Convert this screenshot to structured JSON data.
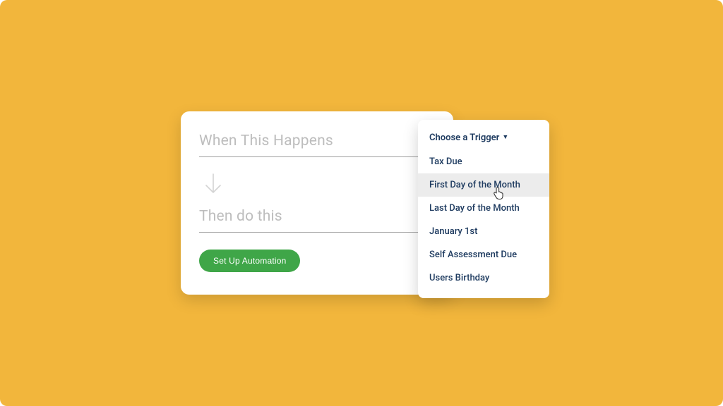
{
  "card": {
    "when_label": "When This Happens",
    "then_label": "Then do this",
    "button_label": "Set Up Automation"
  },
  "dropdown": {
    "header": "Choose a Trigger",
    "items": [
      {
        "label": "Tax Due",
        "hovered": false
      },
      {
        "label": "First Day of the Month",
        "hovered": true
      },
      {
        "label": "Last Day of the Month",
        "hovered": false
      },
      {
        "label": "January 1st",
        "hovered": false
      },
      {
        "label": "Self Assessment Due",
        "hovered": false
      },
      {
        "label": "Users Birthday",
        "hovered": false
      }
    ]
  },
  "colors": {
    "background": "#f2b63c",
    "accent_green": "#3fa648",
    "text_navy": "#1d3a5f"
  }
}
